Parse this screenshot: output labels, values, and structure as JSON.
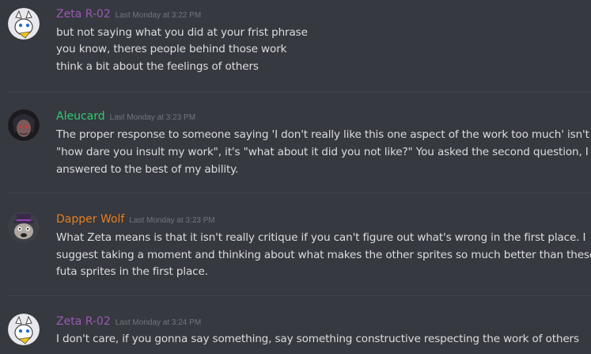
{
  "messages": [
    {
      "author": "Zeta R-02",
      "color": "#9b59b6",
      "timestamp": "Last Monday at 3:22 PM",
      "avatar_icon": "goat-avatar-icon",
      "lines": [
        "but not saying what you did at your frist phrase",
        "you know, theres people behind those work",
        "think a bit about the feelings of others"
      ]
    },
    {
      "author": "Aleucard",
      "color": "#2ecc71",
      "timestamp": "Last Monday at 3:23 PM",
      "avatar_icon": "dark-character-avatar-icon",
      "lines": [
        "The proper response to someone saying 'I don't really like this one aspect of the work too much' isn't",
        "\"how dare you insult my work\", it's \"what about it did you not like?\" You asked the second question, I",
        "answered to the best of my ability."
      ]
    },
    {
      "author": "Dapper Wolf",
      "color": "#e67e22",
      "timestamp": "Last Monday at 3:23 PM",
      "avatar_icon": "wolf-top-hat-avatar-icon",
      "lines": [
        "What Zeta means is that it isn't really critique if you can't figure out what's wrong in the first place. I",
        "suggest taking a moment and thinking about what makes the other sprites so much better than these",
        "futa sprites in the first place."
      ]
    },
    {
      "author": "Zeta R-02",
      "color": "#9b59b6",
      "timestamp": "Last Monday at 3:24 PM",
      "avatar_icon": "goat-avatar-icon",
      "lines": [
        "I don't care, if you gonna say something, say something constructive respecting the work of others"
      ]
    }
  ]
}
